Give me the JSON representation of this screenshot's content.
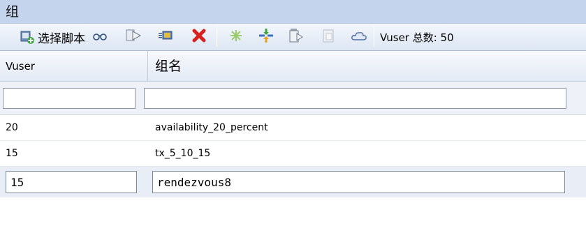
{
  "panel": {
    "title": "组"
  },
  "toolbar": {
    "select_script_label": "选择脚本",
    "vuser_total_label": "Vuser 总数: 50",
    "icons": [
      "select-script-icon",
      "glasses-icon",
      "run-icon",
      "details-icon",
      "delete-icon",
      "sparkle-icon",
      "arrows-icon",
      "copy-icon",
      "paste-icon",
      "cloud-icon"
    ]
  },
  "grid": {
    "columns": [
      "Vuser",
      "组名"
    ],
    "filter": {
      "vuser": "",
      "group": ""
    },
    "rows": [
      {
        "vuser": "20",
        "group": "availability_20_percent"
      },
      {
        "vuser": "15",
        "group": "tx_5_10_15"
      }
    ],
    "edit_row": {
      "vuser": "15",
      "group": "rendezvous8"
    }
  }
}
